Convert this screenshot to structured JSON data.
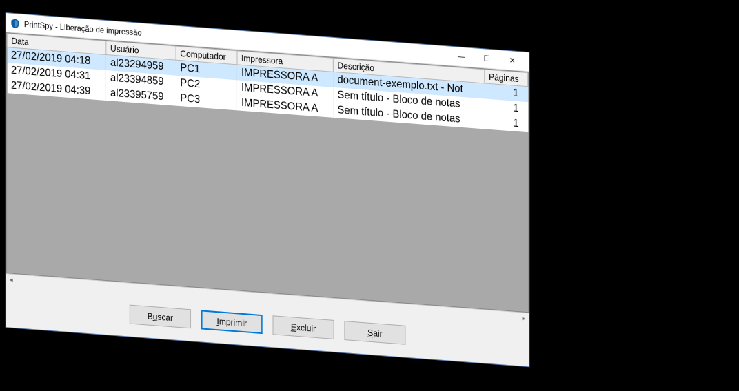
{
  "window": {
    "title": "PrintSpy - Liberação de impressão"
  },
  "table": {
    "columns": {
      "data": "Data",
      "usuario": "Usuário",
      "computador": "Computador",
      "impressora": "Impressora",
      "descricao": "Descrição",
      "paginas": "Páginas"
    },
    "rows": [
      {
        "selected": true,
        "data": "27/02/2019 04:18",
        "usuario": "al23294959",
        "computador": "PC1",
        "impressora": "IMPRESSORA A",
        "descricao": "document-exemplo.txt - Not",
        "paginas": "1"
      },
      {
        "selected": false,
        "data": "27/02/2019 04:31",
        "usuario": "al23394859",
        "computador": "PC2",
        "impressora": "IMPRESSORA A",
        "descricao": "Sem título - Bloco de notas",
        "paginas": "1"
      },
      {
        "selected": false,
        "data": "27/02/2019 04:39",
        "usuario": "al23395759",
        "computador": "PC3",
        "impressora": "IMPRESSORA A",
        "descricao": "Sem título - Bloco de notas",
        "paginas": "1"
      }
    ]
  },
  "buttons": {
    "buscar_pre": "B",
    "buscar_u": "u",
    "buscar_post": "scar",
    "imprimir_pre": "",
    "imprimir_u": "I",
    "imprimir_post": "mprimir",
    "excluir_pre": "",
    "excluir_u": "E",
    "excluir_post": "xcluir",
    "sair_pre": "",
    "sair_u": "S",
    "sair_post": "air"
  },
  "win_controls": {
    "minimize": "—",
    "maximize": "☐",
    "close": "✕"
  }
}
